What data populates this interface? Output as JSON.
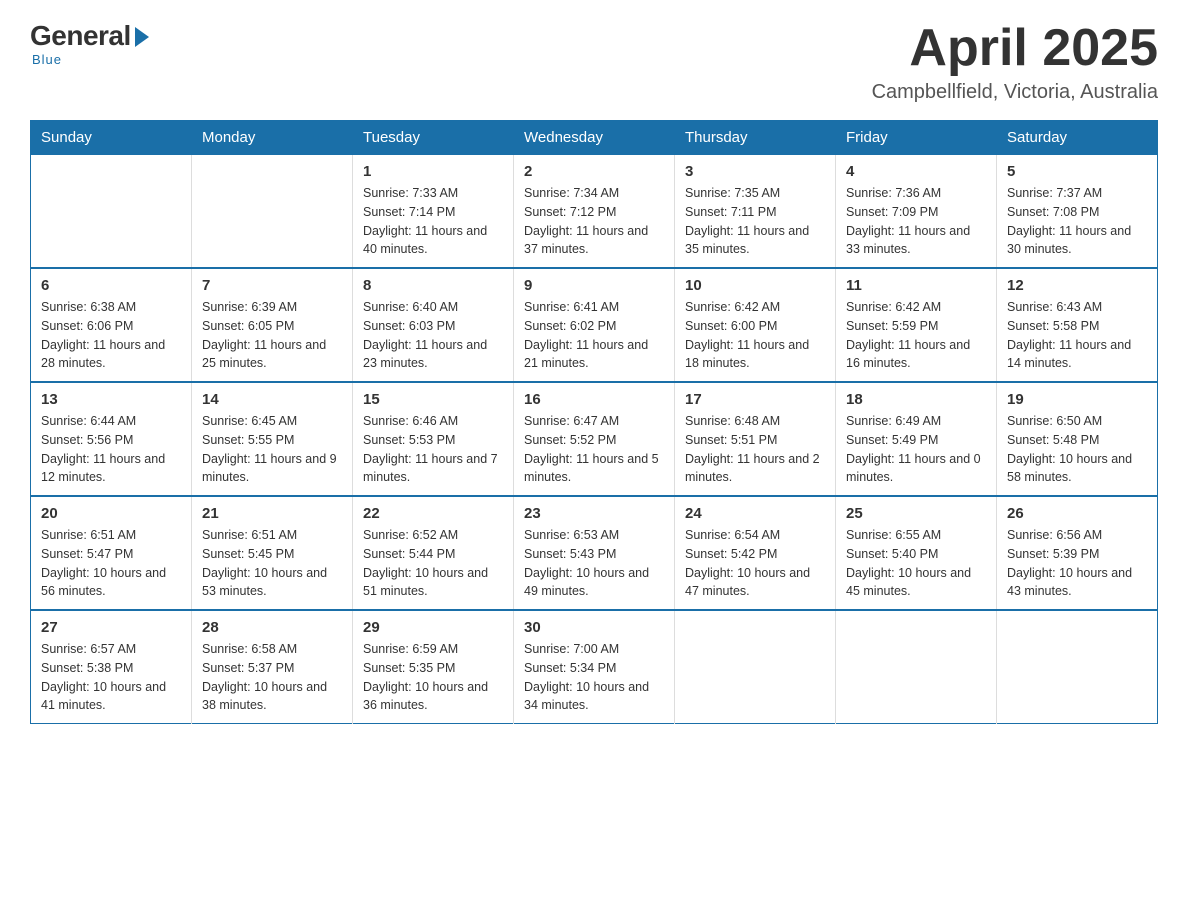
{
  "logo": {
    "general": "General",
    "blue": "Blue",
    "tagline": "Blue"
  },
  "header": {
    "title": "April 2025",
    "subtitle": "Campbellfield, Victoria, Australia"
  },
  "weekdays": [
    "Sunday",
    "Monday",
    "Tuesday",
    "Wednesday",
    "Thursday",
    "Friday",
    "Saturday"
  ],
  "weeks": [
    [
      {
        "day": "",
        "sunrise": "",
        "sunset": "",
        "daylight": ""
      },
      {
        "day": "",
        "sunrise": "",
        "sunset": "",
        "daylight": ""
      },
      {
        "day": "1",
        "sunrise": "Sunrise: 7:33 AM",
        "sunset": "Sunset: 7:14 PM",
        "daylight": "Daylight: 11 hours and 40 minutes."
      },
      {
        "day": "2",
        "sunrise": "Sunrise: 7:34 AM",
        "sunset": "Sunset: 7:12 PM",
        "daylight": "Daylight: 11 hours and 37 minutes."
      },
      {
        "day": "3",
        "sunrise": "Sunrise: 7:35 AM",
        "sunset": "Sunset: 7:11 PM",
        "daylight": "Daylight: 11 hours and 35 minutes."
      },
      {
        "day": "4",
        "sunrise": "Sunrise: 7:36 AM",
        "sunset": "Sunset: 7:09 PM",
        "daylight": "Daylight: 11 hours and 33 minutes."
      },
      {
        "day": "5",
        "sunrise": "Sunrise: 7:37 AM",
        "sunset": "Sunset: 7:08 PM",
        "daylight": "Daylight: 11 hours and 30 minutes."
      }
    ],
    [
      {
        "day": "6",
        "sunrise": "Sunrise: 6:38 AM",
        "sunset": "Sunset: 6:06 PM",
        "daylight": "Daylight: 11 hours and 28 minutes."
      },
      {
        "day": "7",
        "sunrise": "Sunrise: 6:39 AM",
        "sunset": "Sunset: 6:05 PM",
        "daylight": "Daylight: 11 hours and 25 minutes."
      },
      {
        "day": "8",
        "sunrise": "Sunrise: 6:40 AM",
        "sunset": "Sunset: 6:03 PM",
        "daylight": "Daylight: 11 hours and 23 minutes."
      },
      {
        "day": "9",
        "sunrise": "Sunrise: 6:41 AM",
        "sunset": "Sunset: 6:02 PM",
        "daylight": "Daylight: 11 hours and 21 minutes."
      },
      {
        "day": "10",
        "sunrise": "Sunrise: 6:42 AM",
        "sunset": "Sunset: 6:00 PM",
        "daylight": "Daylight: 11 hours and 18 minutes."
      },
      {
        "day": "11",
        "sunrise": "Sunrise: 6:42 AM",
        "sunset": "Sunset: 5:59 PM",
        "daylight": "Daylight: 11 hours and 16 minutes."
      },
      {
        "day": "12",
        "sunrise": "Sunrise: 6:43 AM",
        "sunset": "Sunset: 5:58 PM",
        "daylight": "Daylight: 11 hours and 14 minutes."
      }
    ],
    [
      {
        "day": "13",
        "sunrise": "Sunrise: 6:44 AM",
        "sunset": "Sunset: 5:56 PM",
        "daylight": "Daylight: 11 hours and 12 minutes."
      },
      {
        "day": "14",
        "sunrise": "Sunrise: 6:45 AM",
        "sunset": "Sunset: 5:55 PM",
        "daylight": "Daylight: 11 hours and 9 minutes."
      },
      {
        "day": "15",
        "sunrise": "Sunrise: 6:46 AM",
        "sunset": "Sunset: 5:53 PM",
        "daylight": "Daylight: 11 hours and 7 minutes."
      },
      {
        "day": "16",
        "sunrise": "Sunrise: 6:47 AM",
        "sunset": "Sunset: 5:52 PM",
        "daylight": "Daylight: 11 hours and 5 minutes."
      },
      {
        "day": "17",
        "sunrise": "Sunrise: 6:48 AM",
        "sunset": "Sunset: 5:51 PM",
        "daylight": "Daylight: 11 hours and 2 minutes."
      },
      {
        "day": "18",
        "sunrise": "Sunrise: 6:49 AM",
        "sunset": "Sunset: 5:49 PM",
        "daylight": "Daylight: 11 hours and 0 minutes."
      },
      {
        "day": "19",
        "sunrise": "Sunrise: 6:50 AM",
        "sunset": "Sunset: 5:48 PM",
        "daylight": "Daylight: 10 hours and 58 minutes."
      }
    ],
    [
      {
        "day": "20",
        "sunrise": "Sunrise: 6:51 AM",
        "sunset": "Sunset: 5:47 PM",
        "daylight": "Daylight: 10 hours and 56 minutes."
      },
      {
        "day": "21",
        "sunrise": "Sunrise: 6:51 AM",
        "sunset": "Sunset: 5:45 PM",
        "daylight": "Daylight: 10 hours and 53 minutes."
      },
      {
        "day": "22",
        "sunrise": "Sunrise: 6:52 AM",
        "sunset": "Sunset: 5:44 PM",
        "daylight": "Daylight: 10 hours and 51 minutes."
      },
      {
        "day": "23",
        "sunrise": "Sunrise: 6:53 AM",
        "sunset": "Sunset: 5:43 PM",
        "daylight": "Daylight: 10 hours and 49 minutes."
      },
      {
        "day": "24",
        "sunrise": "Sunrise: 6:54 AM",
        "sunset": "Sunset: 5:42 PM",
        "daylight": "Daylight: 10 hours and 47 minutes."
      },
      {
        "day": "25",
        "sunrise": "Sunrise: 6:55 AM",
        "sunset": "Sunset: 5:40 PM",
        "daylight": "Daylight: 10 hours and 45 minutes."
      },
      {
        "day": "26",
        "sunrise": "Sunrise: 6:56 AM",
        "sunset": "Sunset: 5:39 PM",
        "daylight": "Daylight: 10 hours and 43 minutes."
      }
    ],
    [
      {
        "day": "27",
        "sunrise": "Sunrise: 6:57 AM",
        "sunset": "Sunset: 5:38 PM",
        "daylight": "Daylight: 10 hours and 41 minutes."
      },
      {
        "day": "28",
        "sunrise": "Sunrise: 6:58 AM",
        "sunset": "Sunset: 5:37 PM",
        "daylight": "Daylight: 10 hours and 38 minutes."
      },
      {
        "day": "29",
        "sunrise": "Sunrise: 6:59 AM",
        "sunset": "Sunset: 5:35 PM",
        "daylight": "Daylight: 10 hours and 36 minutes."
      },
      {
        "day": "30",
        "sunrise": "Sunrise: 7:00 AM",
        "sunset": "Sunset: 5:34 PM",
        "daylight": "Daylight: 10 hours and 34 minutes."
      },
      {
        "day": "",
        "sunrise": "",
        "sunset": "",
        "daylight": ""
      },
      {
        "day": "",
        "sunrise": "",
        "sunset": "",
        "daylight": ""
      },
      {
        "day": "",
        "sunrise": "",
        "sunset": "",
        "daylight": ""
      }
    ]
  ]
}
